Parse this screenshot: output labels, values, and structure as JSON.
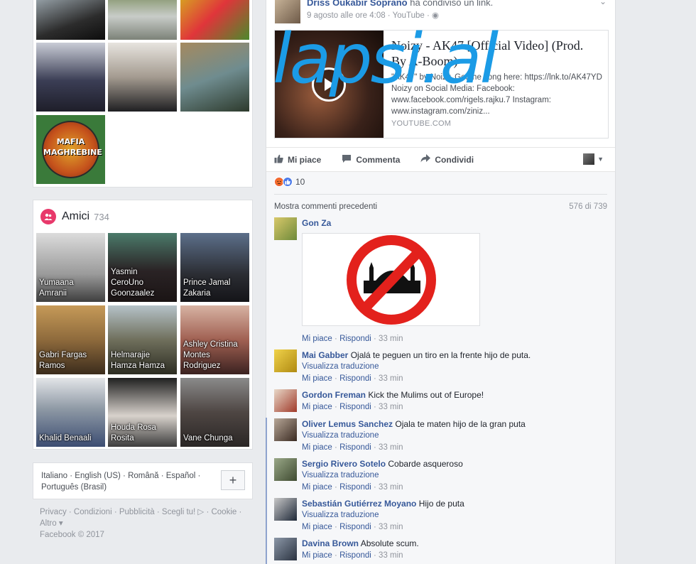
{
  "left": {
    "friends": {
      "title": "Amici",
      "count": "734",
      "items": [
        {
          "name": "Yumaana\nAmranii"
        },
        {
          "name": "Yasmin\nCeroUno\nGoonzaalez"
        },
        {
          "name": "Prince Jamal\nZakaria"
        },
        {
          "name": "Gabri Fargas\nRamos"
        },
        {
          "name": "Helmarajie\nHamza Hamza"
        },
        {
          "name": "Ashley Cristina\nMontes\nRodriguez"
        },
        {
          "name": "Khalid Benaali"
        },
        {
          "name": "Houda Rosa\nRosita"
        },
        {
          "name": "Vane Chunga"
        }
      ]
    },
    "photos": {
      "badge_text": "MAFIA\nMAGHREBINE"
    },
    "languages": {
      "line1": "Italiano · English (US) · Română · Español ·",
      "line2": "Português (Brasil)",
      "plus": "+"
    },
    "footer": {
      "line1": "Privacy · Condizioni · Pubblicità · Scegli tu! ▷ · Cookie ·",
      "line2": "Altro ▾",
      "line3": "Facebook © 2017"
    }
  },
  "post": {
    "author": "Driss Oukabir Soprano",
    "action": "ha condiviso un link.",
    "meta": "9 agosto alle ore 4:08 · YouTube · ◉",
    "link": {
      "title": "Noizy - AK47 [Official Video] (Prod. By A-Boom)",
      "description": "\"AK47\" by Noizy. Get the song here: https://lnk.to/AK47YD Noizy on Social Media: Facebook: www.facebook.com/rigels.rajku.7 Instagram: www.instagram.com/ziniz...",
      "domain": "YOUTUBE.COM"
    },
    "watermark": "lapsi.al",
    "actions": {
      "like": "Mi piace",
      "comment": "Commenta",
      "share": "Condividi"
    },
    "reactions_count": "10",
    "more_comments": "Mostra commenti precedenti",
    "comment_count": "576 di 739",
    "comments": [
      {
        "name": "Gon Za",
        "text": "",
        "has_image": true,
        "translate": "",
        "like": "Mi piace",
        "reply": "Rispondi",
        "time": "33 min"
      },
      {
        "name": "Mai Gabber",
        "text": "Ojalá te peguen un tiro en la frente hijo de puta.",
        "translate": "Visualizza traduzione",
        "like": "Mi piace",
        "reply": "Rispondi",
        "time": "33 min"
      },
      {
        "name": "Gordon Freman",
        "text": "Kick the Mulims out of Europe!",
        "translate": "",
        "like": "Mi piace",
        "reply": "Rispondi",
        "time": "33 min"
      },
      {
        "name": "Oliver Lemus Sanchez",
        "text": "Ojala te maten hijo de la gran puta",
        "translate": "Visualizza traduzione",
        "like": "Mi piace",
        "reply": "Rispondi",
        "time": "33 min"
      },
      {
        "name": "Sergio Rivero Sotelo",
        "text": "Cobarde asqueroso",
        "translate": "Visualizza traduzione",
        "like": "Mi piace",
        "reply": "Rispondi",
        "time": "33 min"
      },
      {
        "name": "Sebastián Gutiérrez Moyano",
        "text": "Hijo de puta",
        "translate": "Visualizza traduzione",
        "like": "Mi piace",
        "reply": "Rispondi",
        "time": "33 min"
      },
      {
        "name": "Davina Brown",
        "text": "Absolute scum.",
        "translate": "",
        "like": "Mi piace",
        "reply": "Rispondi",
        "time": "33 min"
      }
    ]
  },
  "icons": {
    "friends": "friends-icon",
    "like": "thumbs-up-icon",
    "comment": "speech-bubble-icon",
    "share": "share-arrow-icon",
    "play": "play-icon",
    "reaction_angry": "angry-reaction-icon",
    "reaction_like": "like-reaction-icon"
  },
  "colors": {
    "link": "#365899",
    "background": "#e9ebee",
    "friends_badge": "#e8396b",
    "watermark": "#1b9be6"
  }
}
